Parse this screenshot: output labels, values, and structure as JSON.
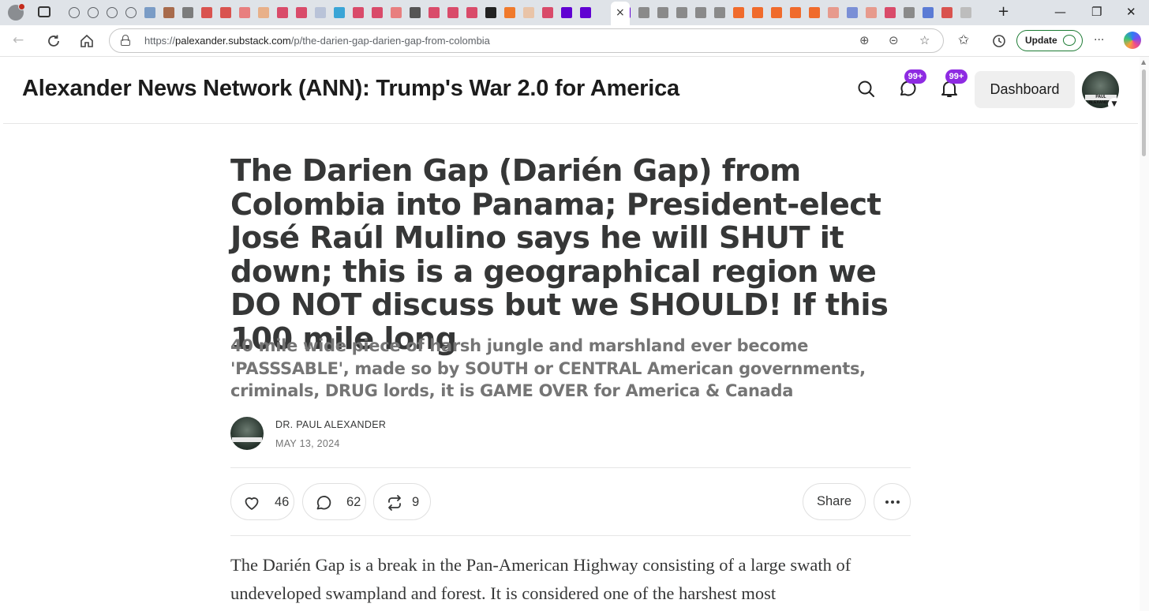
{
  "browser": {
    "tab_favicon_colors": [
      "#c7c7c7",
      "#c7c7c7",
      "#c7c7c7",
      "#c7c7c7",
      "#7a9cc6",
      "#a86b4c",
      "#7c7c7c",
      "#d9534f",
      "#d9534f",
      "#e87f7f",
      "#e8b089",
      "#d94b6a",
      "#d94b6a",
      "#b9c3d8",
      "#3aa5d6",
      "#d94b6a",
      "#d94b6a",
      "#e87f7f",
      "#555555",
      "#d94b6a",
      "#d94b6a",
      "#d94b6a",
      "#222222",
      "#f07a2c",
      "#e9c4a8",
      "#d94b6a",
      "#6001d2",
      "#6001d2"
    ],
    "tab_favicon_colors_after": [
      "#6001d2",
      "#8a8a8a",
      "#8a8a8a",
      "#8a8a8a",
      "#8a8a8a",
      "#8a8a8a",
      "#f06b2c",
      "#f06b2c",
      "#f06b2c",
      "#f06b2c",
      "#f06b2c",
      "#e79a8d",
      "#7a8fd6",
      "#e79a8d",
      "#d94b6a",
      "#8a8a8a",
      "#5b7bd5",
      "#d9534f",
      "#bdbdbd"
    ],
    "active_tab_close": "×",
    "new_tab": "+",
    "minimize": "—",
    "restore": "❐",
    "close": "✕",
    "url_host": "palexander.substack.com",
    "url_prefix": "https://",
    "url_path": "/p/the-darien-gap-darien-gap-from-colombia",
    "update_label": "Update",
    "more_menu": "···"
  },
  "header": {
    "site_title": "Alexander News Network (ANN): Trump's War 2.0 for America",
    "chat_badge": "99+",
    "notifications_badge": "99+",
    "dashboard_label": "Dashboard",
    "avatar_band_text": "PAUL ALEXANDER"
  },
  "article": {
    "title": "The Darien Gap (Darién Gap) from Colombia into Panama; President-elect José Raúl Mulino says he will SHUT it down; this is a geographical region we DO NOT discuss but we SHOULD! If this 100 mile long",
    "subtitle": "40 mile wide piece of harsh jungle and marshland ever become 'PASSSABLE', made so by SOUTH or CENTRAL American governments, criminals, DRUG lords, it is GAME OVER for America & Canada",
    "author": "DR. PAUL ALEXANDER",
    "date": "MAY 13, 2024",
    "likes": "46",
    "comments": "62",
    "restacks": "9",
    "share_label": "Share",
    "body": "The Darién Gap is a break in the Pan-American Highway consisting of a large swath of undeveloped swampland and forest. It is considered one of the harshest most"
  },
  "colors": {
    "badge": "#8e2be2",
    "update_border": "#1d7b34",
    "text": "#363737",
    "muted": "#757575"
  }
}
